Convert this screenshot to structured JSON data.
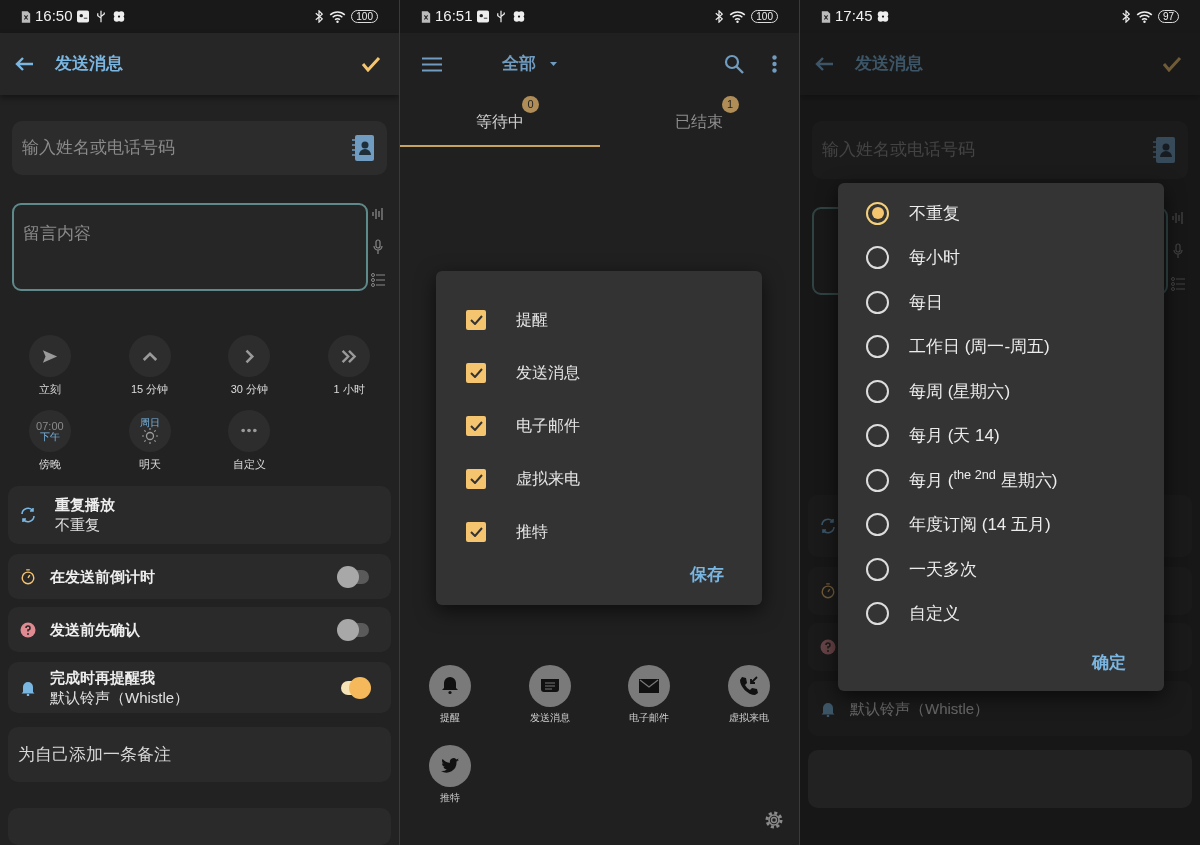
{
  "left_screen": {
    "status_bar": {
      "time": "16:50",
      "battery": "100"
    },
    "app_bar": {
      "title": "发送消息"
    },
    "recipient": {
      "placeholder": "输入姓名或电话号码"
    },
    "message": {
      "placeholder": "留言内容"
    },
    "quick_times": [
      {
        "kind": "send",
        "label": "立刻"
      },
      {
        "kind": "up",
        "label": "15 分钟"
      },
      {
        "kind": "next",
        "label": "30 分钟"
      },
      {
        "kind": "double",
        "label": "1 小时"
      },
      {
        "kind": "clock",
        "time": "07:00",
        "sub": "下午",
        "label": "傍晚"
      },
      {
        "kind": "sun",
        "sub": "周日",
        "label": "明天"
      },
      {
        "kind": "more",
        "label": "自定义"
      }
    ],
    "settings": [
      {
        "kind": "repeat",
        "title": "重复播放",
        "subtitle": "不重复"
      },
      {
        "kind": "timer",
        "title": "在发送前倒计时",
        "on": false
      },
      {
        "kind": "confirm",
        "title": "发送前先确认",
        "on": false
      },
      {
        "kind": "bell",
        "title": "完成时再提醒我",
        "subtitle": "默认铃声（Whistle）",
        "on": true
      }
    ],
    "note": {
      "placeholder": "为自己添加一条备注"
    }
  },
  "middle_screen": {
    "status_bar": {
      "time": "16:51",
      "battery": "100"
    },
    "app_bar": {
      "filter": "全部"
    },
    "tabs": [
      {
        "label": "等待中",
        "count": "0",
        "selected": true
      },
      {
        "label": "已结束",
        "count": "1",
        "selected": false
      }
    ],
    "channels": [
      {
        "kind": "bell",
        "label": "提醒"
      },
      {
        "kind": "message",
        "label": "发送消息"
      },
      {
        "kind": "mail",
        "label": "电子邮件"
      },
      {
        "kind": "call",
        "label": "虚拟来电"
      },
      {
        "kind": "bird",
        "label": "推特"
      }
    ],
    "dialog": {
      "items": [
        {
          "label": "提醒",
          "checked": true
        },
        {
          "label": "发送消息",
          "checked": true
        },
        {
          "label": "电子邮件",
          "checked": true
        },
        {
          "label": "虚拟来电",
          "checked": true
        },
        {
          "label": "推特",
          "checked": true
        }
      ],
      "button": "保存"
    }
  },
  "right_screen": {
    "status_bar": {
      "time": "17:45",
      "battery": "97"
    },
    "app_bar": {
      "title": "发送消息"
    },
    "recipient": {
      "placeholder": "输入姓名或电话号码"
    },
    "settings": [
      {
        "kind": "repeat"
      },
      {
        "kind": "timer"
      },
      {
        "kind": "confirm"
      },
      {
        "kind": "bell",
        "subtitle": "默认铃声（Whistle）"
      }
    ],
    "dialog": {
      "options": [
        {
          "label": "不重复",
          "selected": true
        },
        {
          "label": "每小时",
          "selected": false
        },
        {
          "label": "每日",
          "selected": false
        },
        {
          "label": "工作日 (周一-周五)",
          "selected": false
        },
        {
          "label": "每周 (星期六)",
          "selected": false
        },
        {
          "label": "每月 (天 14)",
          "selected": false
        },
        {
          "label": "每月 ($^{the 2nd}$ 星期六)",
          "selected": false
        },
        {
          "label": "年度订阅 (14 五月)",
          "selected": false
        },
        {
          "label": "一天多次",
          "selected": false
        },
        {
          "label": "自定义",
          "selected": false
        }
      ],
      "button": "确定"
    }
  }
}
